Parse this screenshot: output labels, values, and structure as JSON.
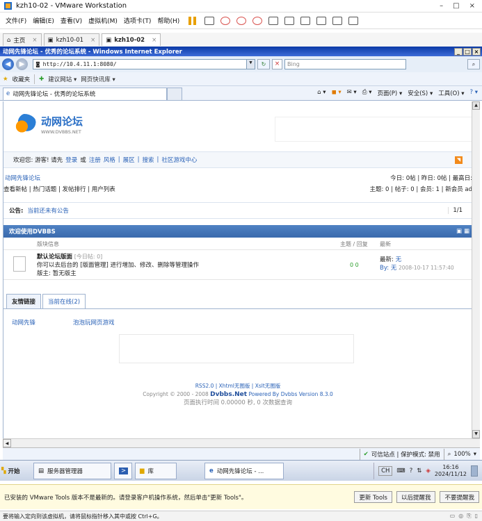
{
  "vm": {
    "title": "kzh10-02 - VMware Workstation",
    "window_controls": [
      "–",
      "□",
      "×"
    ],
    "menu": [
      "文件(F)",
      "编辑(E)",
      "查看(V)",
      "虚拟机(M)",
      "选项卡(T)",
      "帮助(H)"
    ],
    "tabs": [
      {
        "label": "主页"
      },
      {
        "label": "kzh10-01"
      },
      {
        "label": "kzh10-02"
      }
    ],
    "notify_text": "已安装的 VMware Tools 版本不是最新的。请登录客户机操作系统，然后单击\"更新 Tools\"。",
    "notify_buttons": [
      "更新 Tools",
      "以后提醒我",
      "不要提醒我"
    ],
    "status_text": "要将输入定向到该虚拟机，请将鼠标指针移入其中或按 Ctrl+G。"
  },
  "ie": {
    "title": "动网先锋论坛 - 优秀的论坛系统 - Windows Internet Explorer",
    "address": "http://10.4.11.1:8080/",
    "search_placeholder": "Bing",
    "favorites_label": "收藏夹",
    "fav_links": [
      "建议网站 ▾",
      "网页快讯库 ▾"
    ],
    "tab_title": "动网先锋论坛 - 优秀的论坛系统",
    "commands": [
      "页面(P) ▾",
      "安全(S) ▾",
      "工具(O) ▾"
    ],
    "status": {
      "zone": "可信站点 | 保护模式: 禁用",
      "zoom": "100%"
    }
  },
  "forum": {
    "brand": "动网论坛",
    "brand_sub": "WWW.DVBBS.NET",
    "welcome": "欢迎您: 游客! 请先",
    "login": "登录",
    "or": "或",
    "register": "注册",
    "nav_links": [
      "风格",
      "|",
      "展区",
      "|",
      "搜索",
      "|",
      "社区游戏中心"
    ],
    "breadcrumb": "动网先锋论坛",
    "sub_links": "查看新帖 | 热门话题 | 发帖排行 | 用户列表",
    "stats_line1": "今日: 0帖 | 昨日: 0帖 | 最高日:",
    "stats_line2": "主题: 0 | 帖子: 0 | 会员: 1 | 新会员 ad",
    "notice_label": "公告:",
    "notice_text": "当前还未有公告",
    "notice_pager": "1/1",
    "panel_title": "欢迎使用DVBBS",
    "col_board": "版块信息",
    "col_topics": "主题 / 回复",
    "col_latest": "最新",
    "board_name": "默认论坛版面",
    "board_today": "[今日帖: 0]",
    "board_desc": "你可以去后台的 [版面管理] 进行增加、修改、删除等管理操作",
    "board_mod": "版主: 暂无版主",
    "board_counts": "0  0",
    "latest_label": "最新:",
    "latest_value": "无",
    "latest_by": "By:",
    "latest_by_value": "无",
    "latest_time": "2008-10-17 11:57:40",
    "tab_links": "友情链接",
    "tab_online": "当前在线(2)",
    "link1": "动网先锋",
    "link2": "泡泡玩网页游戏",
    "footer1": "RSS2.0 | Xhtml无图版 | Xslt无图版",
    "footer2a": "Copyright © 2000 - 2008",
    "footer2b": "Dvbbs.Net",
    "footer2c": "Powered By Dvbbs Version 8.3.0",
    "footer3": "页面执行时间 0.00000 秒, 0 次数据查询"
  },
  "taskbar": {
    "start": "开始",
    "items": [
      "服务器管理器",
      "库",
      "动网先锋论坛 - ..."
    ],
    "lang": "CH",
    "time": "16:16",
    "date": "2024/11/12"
  }
}
